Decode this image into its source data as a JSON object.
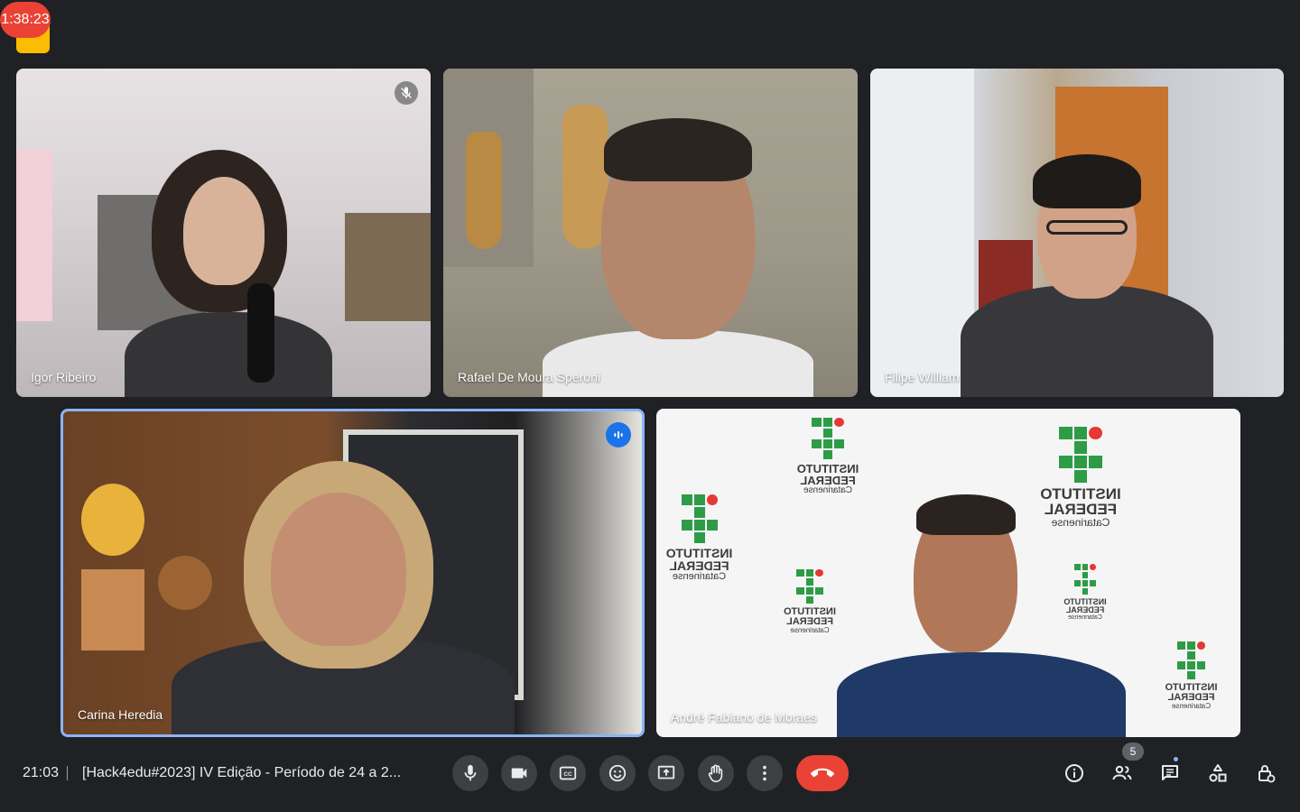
{
  "recording": {
    "timer": "1:38:23"
  },
  "participants": [
    {
      "name": "Igor Ribeiro",
      "muted": true
    },
    {
      "name": "Rafael De Moura Speroni"
    },
    {
      "name": "Filipe William"
    },
    {
      "name": "Carina Heredia",
      "speaking": true
    },
    {
      "name": "André Fabiano de Moraes"
    }
  ],
  "backdrop_logo": {
    "line1": "INSTITUTO",
    "line2": "FEDERAL",
    "line3": "Catarinense"
  },
  "footer": {
    "time": "21:03",
    "meeting_title": "[Hack4edu#2023] IV Edição - Período de 24 a 2...",
    "participant_count": "5"
  },
  "colors": {
    "background": "#202124",
    "accent": "#8ab4f8",
    "end_call": "#ea4335",
    "control": "#3c4043"
  },
  "icons": {
    "controls": [
      "mic-icon",
      "camera-icon",
      "captions-icon",
      "emoji-icon",
      "present-icon",
      "raise-hand-icon",
      "more-options-icon",
      "end-call-icon"
    ],
    "right": [
      "info-icon",
      "people-icon",
      "chat-icon",
      "activities-icon",
      "host-controls-icon"
    ]
  }
}
